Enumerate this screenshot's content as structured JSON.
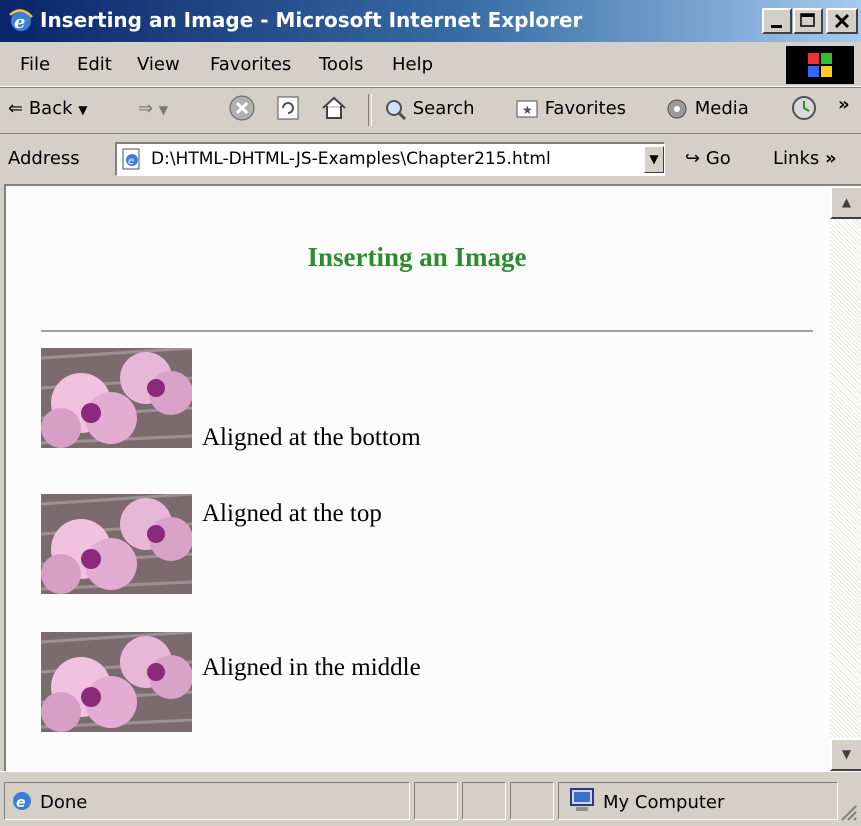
{
  "window": {
    "title": "Inserting an Image - Microsoft Internet Explorer",
    "title_bar_color": "#0a246a"
  },
  "menu": {
    "items": [
      "File",
      "Edit",
      "View",
      "Favorites",
      "Tools",
      "Help"
    ]
  },
  "toolbar": {
    "back_label": "Back",
    "search_label": "Search",
    "favorites_label": "Favorites",
    "media_label": "Media",
    "overflow": "»"
  },
  "address": {
    "label": "Address",
    "value": "D:\\HTML-DHTML-JS-Examples\\Chapter215.html",
    "go_label": "Go",
    "links_label": "Links",
    "links_overflow": "»"
  },
  "page": {
    "heading": "Inserting an Image",
    "heading_color": "#2e8b2e",
    "items": [
      {
        "caption": "Aligned at the bottom",
        "image": "flower-image"
      },
      {
        "caption": "Aligned at the top",
        "image": "flower-image"
      },
      {
        "caption": "Aligned in the middle",
        "image": "flower-image"
      }
    ]
  },
  "status": {
    "text": "Done",
    "zone": "My Computer"
  }
}
